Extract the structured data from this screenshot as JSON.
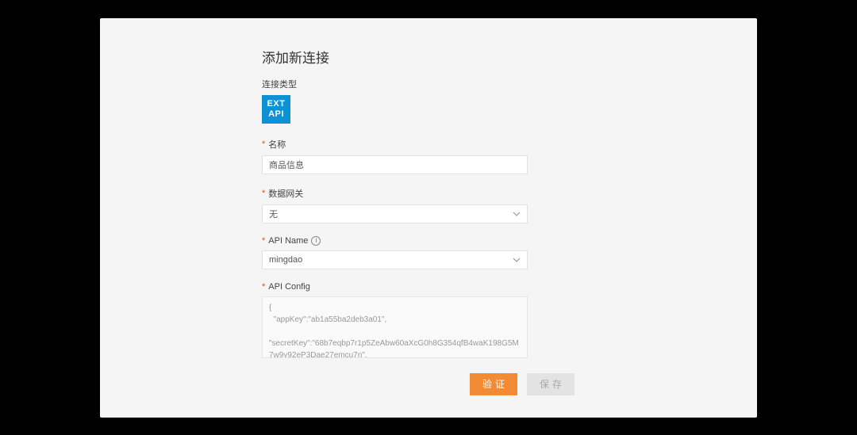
{
  "title": "添加新连接",
  "connType": {
    "label": "连接类型",
    "tagLine1": "EXT",
    "tagLine2": "API"
  },
  "nameField": {
    "label": "名称",
    "value": "商品信息"
  },
  "gatewayField": {
    "label": "数据网关",
    "value": "无"
  },
  "apiNameField": {
    "label": "API Name",
    "value": "mingdao"
  },
  "apiConfigField": {
    "label": "API Config",
    "value": "{\n  \"appKey\":\"ab1a55ba2deb3a01\",\n  \"secretKey\":\"68b7eqbp7r1p5ZeAbw60aXcG0h8G354qfB4waK198G5M7w9y92eP3Dae27emcu7n\","
  },
  "buttons": {
    "verify": "验证",
    "save": "保存"
  }
}
